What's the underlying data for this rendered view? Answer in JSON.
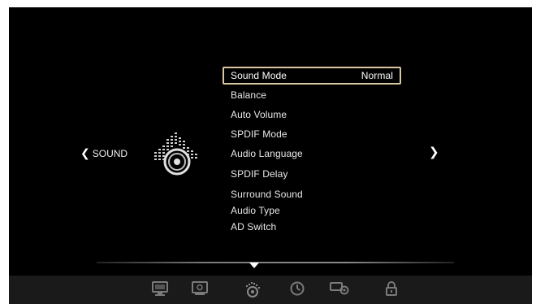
{
  "nav": {
    "current_page": "SOUND"
  },
  "menu": {
    "items": [
      {
        "label": "Sound Mode",
        "value": "Normal"
      },
      {
        "label": "Balance"
      },
      {
        "label": "Auto Volume"
      },
      {
        "label": "SPDIF Mode"
      },
      {
        "label": "Audio Language"
      },
      {
        "label": "SPDIF Delay"
      },
      {
        "label": "Surround Sound"
      },
      {
        "label": "Audio Type"
      },
      {
        "label": "AD Switch"
      }
    ]
  },
  "bottom_bar": {
    "tabs": [
      {
        "icon": "picture-icon"
      },
      {
        "icon": "screen-icon"
      },
      {
        "icon": "sound-speaker-icon",
        "active": true
      },
      {
        "icon": "clock-icon"
      },
      {
        "icon": "options-icon"
      },
      {
        "icon": "lock-icon"
      }
    ]
  },
  "colors": {
    "background": "#000000",
    "selection_border": "#d8c7a0",
    "text": "#e8e8e8",
    "bar": "#1a1a1a"
  }
}
